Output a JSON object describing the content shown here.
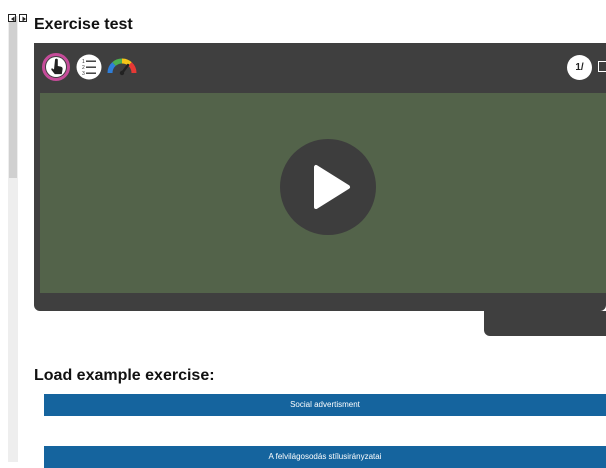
{
  "page": {
    "title": "Exercise test"
  },
  "player": {
    "toolbar_icons": [
      "touch-hand-icon",
      "numbered-list-icon",
      "rainbow-gauge-icon"
    ],
    "counter": "1/",
    "colors": {
      "chrome": "#3f3f3f",
      "stage": "#53634a",
      "play_button": "#3d3d3d"
    }
  },
  "examples": {
    "heading": "Load example exercise:",
    "buttons": [
      {
        "label": "Social advertisment"
      },
      {
        "label": "A felvilágosodás stílusirányzatai"
      }
    ],
    "button_color": "#15649e"
  }
}
